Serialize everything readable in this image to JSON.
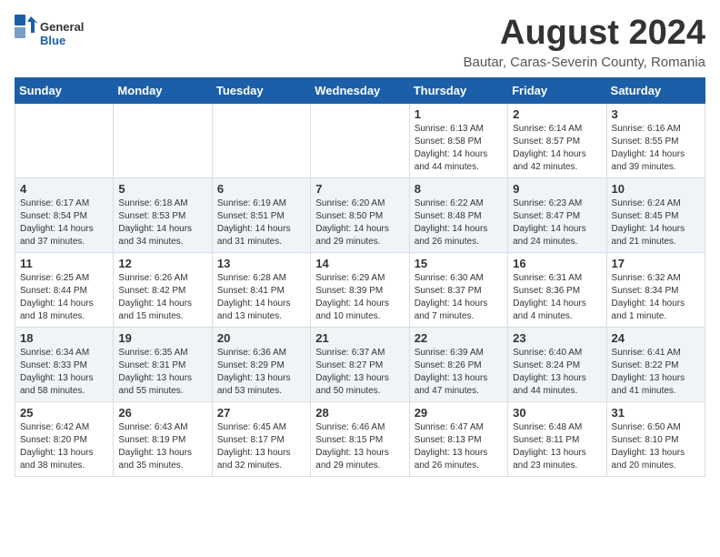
{
  "logo": {
    "general": "General",
    "blue": "Blue"
  },
  "title": "August 2024",
  "subtitle": "Bautar, Caras-Severin County, Romania",
  "weekdays": [
    "Sunday",
    "Monday",
    "Tuesday",
    "Wednesday",
    "Thursday",
    "Friday",
    "Saturday"
  ],
  "weeks": [
    [
      {
        "day": "",
        "info": ""
      },
      {
        "day": "",
        "info": ""
      },
      {
        "day": "",
        "info": ""
      },
      {
        "day": "",
        "info": ""
      },
      {
        "day": "1",
        "info": "Sunrise: 6:13 AM\nSunset: 8:58 PM\nDaylight: 14 hours and 44 minutes."
      },
      {
        "day": "2",
        "info": "Sunrise: 6:14 AM\nSunset: 8:57 PM\nDaylight: 14 hours and 42 minutes."
      },
      {
        "day": "3",
        "info": "Sunrise: 6:16 AM\nSunset: 8:55 PM\nDaylight: 14 hours and 39 minutes."
      }
    ],
    [
      {
        "day": "4",
        "info": "Sunrise: 6:17 AM\nSunset: 8:54 PM\nDaylight: 14 hours and 37 minutes."
      },
      {
        "day": "5",
        "info": "Sunrise: 6:18 AM\nSunset: 8:53 PM\nDaylight: 14 hours and 34 minutes."
      },
      {
        "day": "6",
        "info": "Sunrise: 6:19 AM\nSunset: 8:51 PM\nDaylight: 14 hours and 31 minutes."
      },
      {
        "day": "7",
        "info": "Sunrise: 6:20 AM\nSunset: 8:50 PM\nDaylight: 14 hours and 29 minutes."
      },
      {
        "day": "8",
        "info": "Sunrise: 6:22 AM\nSunset: 8:48 PM\nDaylight: 14 hours and 26 minutes."
      },
      {
        "day": "9",
        "info": "Sunrise: 6:23 AM\nSunset: 8:47 PM\nDaylight: 14 hours and 24 minutes."
      },
      {
        "day": "10",
        "info": "Sunrise: 6:24 AM\nSunset: 8:45 PM\nDaylight: 14 hours and 21 minutes."
      }
    ],
    [
      {
        "day": "11",
        "info": "Sunrise: 6:25 AM\nSunset: 8:44 PM\nDaylight: 14 hours and 18 minutes."
      },
      {
        "day": "12",
        "info": "Sunrise: 6:26 AM\nSunset: 8:42 PM\nDaylight: 14 hours and 15 minutes."
      },
      {
        "day": "13",
        "info": "Sunrise: 6:28 AM\nSunset: 8:41 PM\nDaylight: 14 hours and 13 minutes."
      },
      {
        "day": "14",
        "info": "Sunrise: 6:29 AM\nSunset: 8:39 PM\nDaylight: 14 hours and 10 minutes."
      },
      {
        "day": "15",
        "info": "Sunrise: 6:30 AM\nSunset: 8:37 PM\nDaylight: 14 hours and 7 minutes."
      },
      {
        "day": "16",
        "info": "Sunrise: 6:31 AM\nSunset: 8:36 PM\nDaylight: 14 hours and 4 minutes."
      },
      {
        "day": "17",
        "info": "Sunrise: 6:32 AM\nSunset: 8:34 PM\nDaylight: 14 hours and 1 minute."
      }
    ],
    [
      {
        "day": "18",
        "info": "Sunrise: 6:34 AM\nSunset: 8:33 PM\nDaylight: 13 hours and 58 minutes."
      },
      {
        "day": "19",
        "info": "Sunrise: 6:35 AM\nSunset: 8:31 PM\nDaylight: 13 hours and 55 minutes."
      },
      {
        "day": "20",
        "info": "Sunrise: 6:36 AM\nSunset: 8:29 PM\nDaylight: 13 hours and 53 minutes."
      },
      {
        "day": "21",
        "info": "Sunrise: 6:37 AM\nSunset: 8:27 PM\nDaylight: 13 hours and 50 minutes."
      },
      {
        "day": "22",
        "info": "Sunrise: 6:39 AM\nSunset: 8:26 PM\nDaylight: 13 hours and 47 minutes."
      },
      {
        "day": "23",
        "info": "Sunrise: 6:40 AM\nSunset: 8:24 PM\nDaylight: 13 hours and 44 minutes."
      },
      {
        "day": "24",
        "info": "Sunrise: 6:41 AM\nSunset: 8:22 PM\nDaylight: 13 hours and 41 minutes."
      }
    ],
    [
      {
        "day": "25",
        "info": "Sunrise: 6:42 AM\nSunset: 8:20 PM\nDaylight: 13 hours and 38 minutes."
      },
      {
        "day": "26",
        "info": "Sunrise: 6:43 AM\nSunset: 8:19 PM\nDaylight: 13 hours and 35 minutes."
      },
      {
        "day": "27",
        "info": "Sunrise: 6:45 AM\nSunset: 8:17 PM\nDaylight: 13 hours and 32 minutes."
      },
      {
        "day": "28",
        "info": "Sunrise: 6:46 AM\nSunset: 8:15 PM\nDaylight: 13 hours and 29 minutes."
      },
      {
        "day": "29",
        "info": "Sunrise: 6:47 AM\nSunset: 8:13 PM\nDaylight: 13 hours and 26 minutes."
      },
      {
        "day": "30",
        "info": "Sunrise: 6:48 AM\nSunset: 8:11 PM\nDaylight: 13 hours and 23 minutes."
      },
      {
        "day": "31",
        "info": "Sunrise: 6:50 AM\nSunset: 8:10 PM\nDaylight: 13 hours and 20 minutes."
      }
    ]
  ]
}
